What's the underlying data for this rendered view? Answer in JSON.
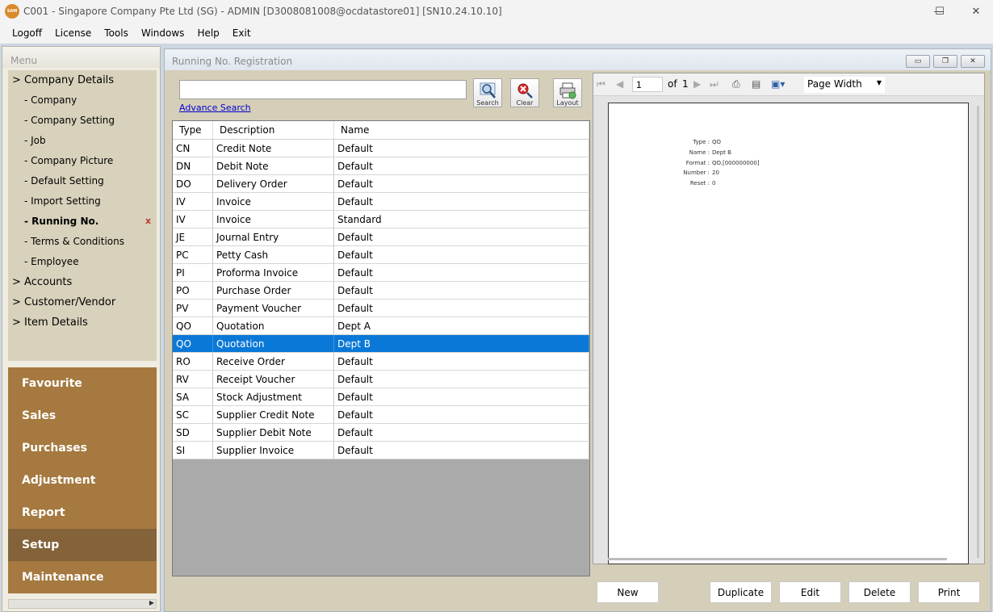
{
  "window": {
    "icon_text": "SAM",
    "title": "C001 - Singapore Company Pte Ltd (SG) - ADMIN [D3008081008@ocdatastore01] [SN10.24.10.10]",
    "controls": {
      "minimize": "—",
      "maximize": "☐",
      "close": "✕"
    }
  },
  "menubar": [
    "Logoff",
    "License",
    "Tools",
    "Windows",
    "Help",
    "Exit"
  ],
  "sidebar": {
    "header": "Menu",
    "tree": [
      {
        "label": "> Company Details",
        "level": 0
      },
      {
        "label": "- Company",
        "level": 1
      },
      {
        "label": "- Company Setting",
        "level": 1
      },
      {
        "label": "- Job",
        "level": 1
      },
      {
        "label": "- Company Picture",
        "level": 1
      },
      {
        "label": "- Default Setting",
        "level": 1
      },
      {
        "label": "- Import Setting",
        "level": 1
      },
      {
        "label": "- Running No.",
        "level": 1,
        "active": true
      },
      {
        "label": "- Terms & Conditions",
        "level": 1
      },
      {
        "label": "- Employee",
        "level": 1
      },
      {
        "label": "> Accounts",
        "level": 0
      },
      {
        "label": "> Customer/Vendor",
        "level": 0
      },
      {
        "label": "> Item Details",
        "level": 0
      }
    ],
    "active_close": "x",
    "groups": [
      "Favourite",
      "Sales",
      "Purchases",
      "Adjustment",
      "Report",
      "Setup",
      "Maintenance"
    ],
    "active_group": "Setup"
  },
  "main": {
    "title": "Running No. Registration",
    "search": {
      "value": "",
      "advance_label": "Advance Search"
    },
    "tools": {
      "search": "Search",
      "clear": "Clear",
      "layout": "Layout"
    },
    "grid": {
      "columns": [
        "Type",
        "Description",
        "Name"
      ],
      "rows": [
        [
          "CN",
          "Credit Note",
          "Default"
        ],
        [
          "DN",
          "Debit Note",
          "Default"
        ],
        [
          "DO",
          "Delivery Order",
          "Default"
        ],
        [
          "IV",
          "Invoice",
          "Default"
        ],
        [
          "IV",
          "Invoice",
          "Standard"
        ],
        [
          "JE",
          "Journal Entry",
          "Default"
        ],
        [
          "PC",
          "Petty Cash",
          "Default"
        ],
        [
          "PI",
          "Proforma Invoice",
          "Default"
        ],
        [
          "PO",
          "Purchase Order",
          "Default"
        ],
        [
          "PV",
          "Payment Voucher",
          "Default"
        ],
        [
          "QO",
          "Quotation",
          "Dept A"
        ],
        [
          "QO",
          "Quotation",
          "Dept B"
        ],
        [
          "RO",
          "Receive Order",
          "Default"
        ],
        [
          "RV",
          "Receipt Voucher",
          "Default"
        ],
        [
          "SA",
          "Stock Adjustment",
          "Default"
        ],
        [
          "SC",
          "Supplier Credit Note",
          "Default"
        ],
        [
          "SD",
          "Supplier Debit Note",
          "Default"
        ],
        [
          "SI",
          "Supplier Invoice",
          "Default"
        ]
      ],
      "selected_index": 11
    },
    "preview": {
      "page_current": "1",
      "of_label": "of",
      "page_total": "1",
      "zoom": "Page Width",
      "fields": [
        {
          "label": "Type :",
          "value": "QO"
        },
        {
          "label": "Name :",
          "value": "Dept B"
        },
        {
          "label": "Format :",
          "value": "QO.[000000000]"
        },
        {
          "label": "Number :",
          "value": "20"
        },
        {
          "label": "Reset :",
          "value": "0"
        }
      ]
    },
    "buttons": {
      "new": "New",
      "duplicate": "Duplicate",
      "edit": "Edit",
      "delete": "Delete",
      "print": "Print"
    }
  }
}
